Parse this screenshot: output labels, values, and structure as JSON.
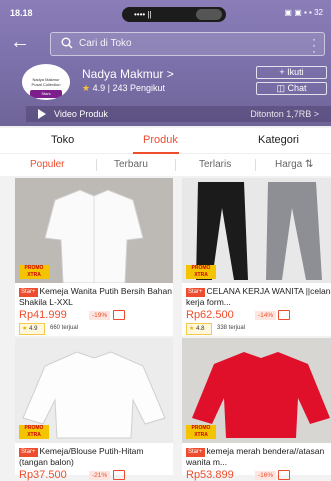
{
  "status_bar": {
    "time": "18.18",
    "pill_text": "•••• ||",
    "right_icons": "▣ ▣ ▪ ▪ 32"
  },
  "search": {
    "placeholder": "Cari di Toko"
  },
  "shop": {
    "name": "Nadya Makmur >",
    "rating": "4.9",
    "followers": "243 Pengikut",
    "logo_line1": "Nadya Makmur",
    "logo_line2": "Pusat Collection",
    "logo_tag": "Stars",
    "follow_label": "+ Ikuti",
    "chat_label": "Chat"
  },
  "video_bar": {
    "label": "Video Produk",
    "views": "Ditonton 1,7RB >"
  },
  "tabs": [
    "Toko",
    "Produk",
    "Kategori"
  ],
  "active_tab": "Produk",
  "sort": [
    "Populer",
    "Terbaru",
    "Terlaris",
    "Harga ⇅"
  ],
  "active_sort": "Populer",
  "products": [
    {
      "title": "Kemeja Wanita Putih Bersih Bahan Shakila L-XXL",
      "badge": "Star+",
      "price": "Rp41.999",
      "discount": "-19%",
      "rating": "4.9",
      "sold": "660 terjual",
      "promo": "PROMO XTRA"
    },
    {
      "title": "CELANA KERJA WANITA ||celana kerja form...",
      "badge": "Star+",
      "price": "Rp62.500",
      "discount": "-14%",
      "rating": "4.8",
      "sold": "338 terjual",
      "promo": "PROMO XTRA"
    },
    {
      "title": "Kemeja/Blouse Putih-Hitam (tangan balon)",
      "badge": "Star+",
      "price": "Rp37.500",
      "discount": "-21%",
      "promo": "PROMO XTRA"
    },
    {
      "title": "kemeja merah bendera//atasan wanita m...",
      "badge": "Star+",
      "price": "Rp53.899",
      "discount": "-16%",
      "promo": "PROMO XTRA"
    }
  ],
  "colors": {
    "header": "#7e72ad",
    "accent": "#ee4d2d",
    "star": "#f7c33e"
  }
}
